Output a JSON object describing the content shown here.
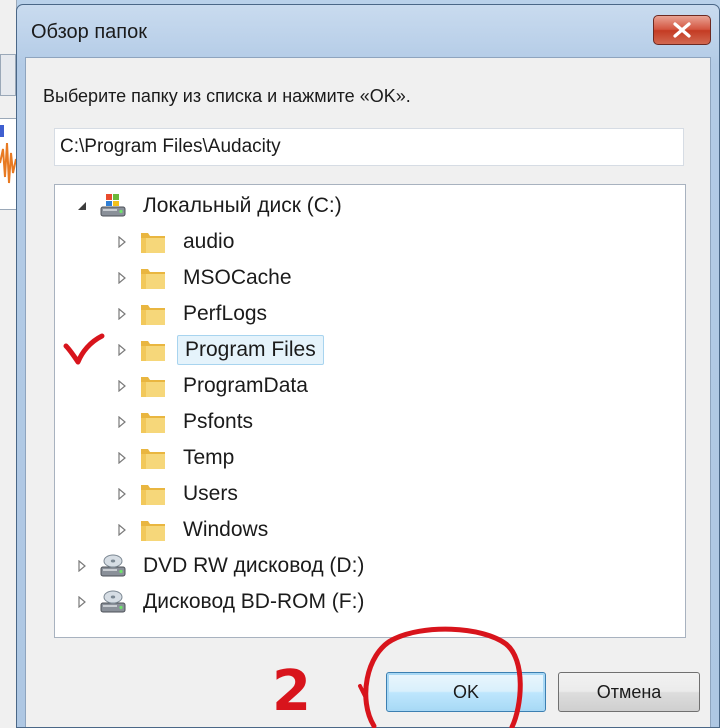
{
  "window": {
    "title": "Обзор папок",
    "close_icon": "close-icon"
  },
  "instruction": "Выберите папку из списка и нажмите «OK».",
  "path": {
    "value": "C:\\Program Files\\Audacity"
  },
  "tree": {
    "root": {
      "label": "Локальный диск (C:)",
      "icon": "hard-drive-icon",
      "expanded": true
    },
    "folders": [
      {
        "label": "audio"
      },
      {
        "label": "MSOCache"
      },
      {
        "label": "PerfLogs"
      },
      {
        "label": "Program Files",
        "selected": true
      },
      {
        "label": "ProgramData"
      },
      {
        "label": "Psfonts"
      },
      {
        "label": "Temp"
      },
      {
        "label": "Users"
      },
      {
        "label": "Windows"
      }
    ],
    "drives": [
      {
        "label": "DVD RW дисковод (D:)",
        "icon": "optical-drive-icon"
      },
      {
        "label": "Дисковод BD-ROM (F:)",
        "icon": "optical-drive-icon"
      }
    ]
  },
  "buttons": {
    "ok": "OK",
    "cancel": "Отмена"
  },
  "annotations": {
    "step_number": "2",
    "color": "#d8141c"
  },
  "colors": {
    "selection_bg": "#e5f3fb",
    "folder": "#f3cd62",
    "close_button": "#c43b23"
  }
}
